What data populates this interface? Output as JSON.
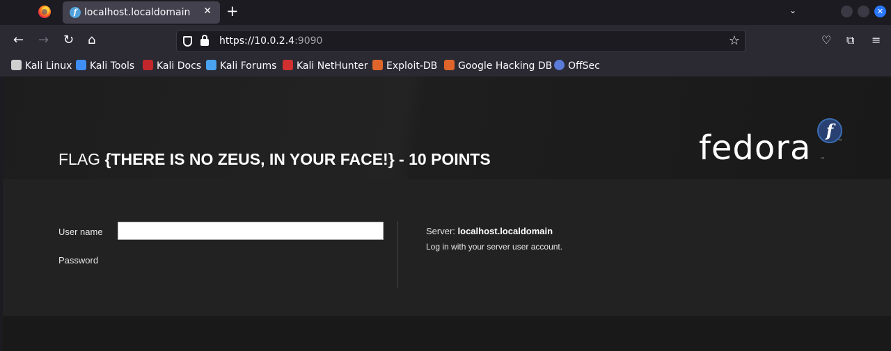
{
  "browser": {
    "tab": {
      "title": "localhost.localdomain",
      "close": "✕",
      "favicon": "f"
    },
    "new_tab": "+",
    "tab_list": "⌄",
    "window_close": "✕",
    "url": {
      "host": "https://10.0.2.4",
      "port": ":9090"
    },
    "bookmarks": [
      {
        "label": "Kali Linux",
        "color": "#cfcfcf"
      },
      {
        "label": "Kali Tools",
        "color": "#3f8ef5"
      },
      {
        "label": "Kali Docs",
        "color": "#c3272b"
      },
      {
        "label": "Kali Forums",
        "color": "#4aa3f0"
      },
      {
        "label": "Kali NetHunter",
        "color": "#d13030"
      },
      {
        "label": "Exploit-DB",
        "color": "#e0652b"
      },
      {
        "label": "Google Hacking DB",
        "color": "#e0652b"
      },
      {
        "label": "OffSec",
        "color": "#5a7bd8"
      }
    ]
  },
  "page": {
    "title_prefix": "FLAG ",
    "title_strong": "{THERE IS NO ZEUS, IN YOUR FACE!} - 10 POINTS",
    "logo_text": "fedora",
    "logo_badge": "f",
    "logo_tm": "™",
    "login": {
      "username_label": "User name",
      "username_value": "",
      "password_label": "Password",
      "server_label": "Server: ",
      "server_host": "localhost.localdomain",
      "hint": "Log in with your server user account."
    }
  },
  "colors": {
    "accent": "#2a78ff",
    "fedora_blue": "#294172"
  }
}
